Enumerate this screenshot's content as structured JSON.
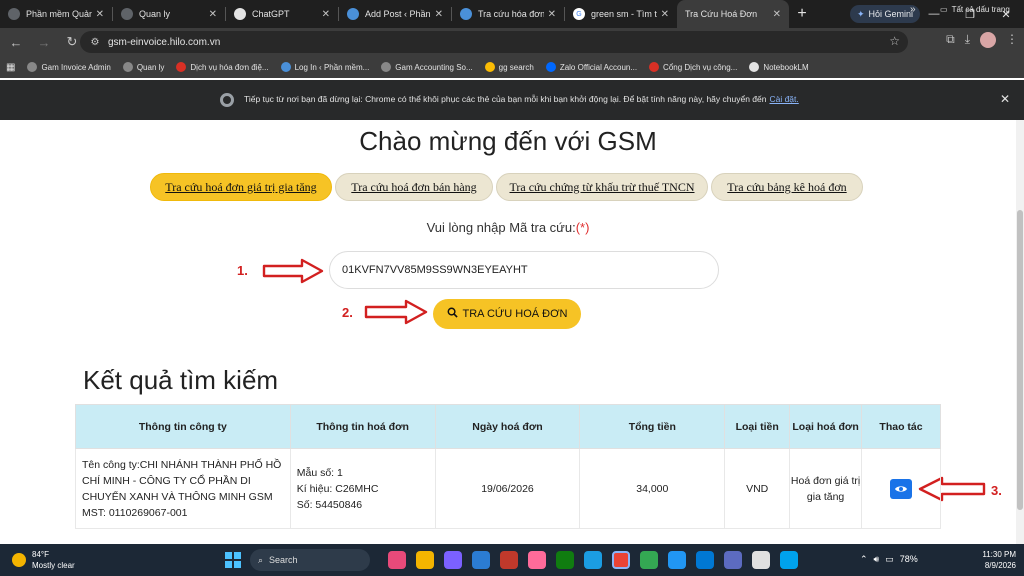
{
  "browser": {
    "tabs": [
      {
        "label": "Phần mềm Quản"
      },
      {
        "label": "Quan ly"
      },
      {
        "label": "ChatGPT"
      },
      {
        "label": "Add Post ‹ Phần"
      },
      {
        "label": "Tra cứu hóa đơn"
      },
      {
        "label": "green sm - Tìm t"
      },
      {
        "label": "Tra Cứu Hoá Đơn"
      }
    ],
    "gemini_label": "Hỏi Gemini",
    "url": "gsm-einvoice.hilo.com.vn",
    "bookmarks": [
      {
        "label": "Gam Invoice Admin"
      },
      {
        "label": "Quan ly"
      },
      {
        "label": "Dịch vụ hóa đơn điệ..."
      },
      {
        "label": "Log In ‹ Phần mềm..."
      },
      {
        "label": "Gam Accounting So..."
      },
      {
        "label": "gg search"
      },
      {
        "label": "Zalo Official Accoun..."
      },
      {
        "label": "Cổng Dịch vụ công..."
      },
      {
        "label": "NotebookLM"
      }
    ],
    "all_bookmarks": "Tất cả dấu trang",
    "infobar": {
      "message": "Tiếp tục từ nơi bạn đã dừng lại: Chrome có thể khôi phục các thẻ của bạn mỗi khi bạn khởi động lại. Để bật tính năng này, hãy chuyển đến",
      "link": "Cài đặt."
    }
  },
  "page": {
    "title": "Chào mừng đến với GSM",
    "tabs": [
      {
        "label": "Tra cứu hoá đơn giá trị gia tăng",
        "active": true
      },
      {
        "label": "Tra cứu hoá đơn bán hàng",
        "active": false
      },
      {
        "label": "Tra cứu chứng từ khấu trừ thuế TNCN",
        "active": false
      },
      {
        "label": "Tra cứu bảng kê hoá đơn",
        "active": false
      }
    ],
    "prompt": "Vui lòng nhập Mã tra cứu:",
    "required_mark": "(*)",
    "lookup_code": "01KVFN7VV85M9SS9WN3EYEAYHT",
    "search_button": "TRA CỨU HOÁ ĐƠN",
    "annotations": {
      "step1": "1.",
      "step2": "2.",
      "step3": "3."
    },
    "accent_color": "#f6c325",
    "results_title": "Kết quả tìm kiếm",
    "table": {
      "headers": [
        "Thông tin công ty",
        "Thông tin hoá đơn",
        "Ngày hoá đơn",
        "Tổng tiền",
        "Loại tiền",
        "Loại hoá đơn",
        "Thao tác"
      ],
      "rows": [
        {
          "company_name": "Tên công ty:CHI NHÁNH THÀNH PHỐ HỒ CHÍ MINH - CÔNG TY CỔ PHẦN DI CHUYỂN XANH VÀ THÔNG MINH GSM",
          "tax_id": "MST: 0110269067-001",
          "form_no": "Mẫu số: 1",
          "symbol": "Kí hiệu: C26MHC",
          "number": "Số: 54450846",
          "date": "19/06/2026",
          "total": "34,000",
          "currency": "VND",
          "invoice_type": "Hoá đơn giá trị gia tăng",
          "action_icon": "eye-icon"
        }
      ]
    }
  },
  "taskbar": {
    "temperature": "84°F",
    "weather": "Mostly clear",
    "search": "Search",
    "battery": "78%",
    "time": "11:30 PM",
    "date": "8/9/2026"
  }
}
